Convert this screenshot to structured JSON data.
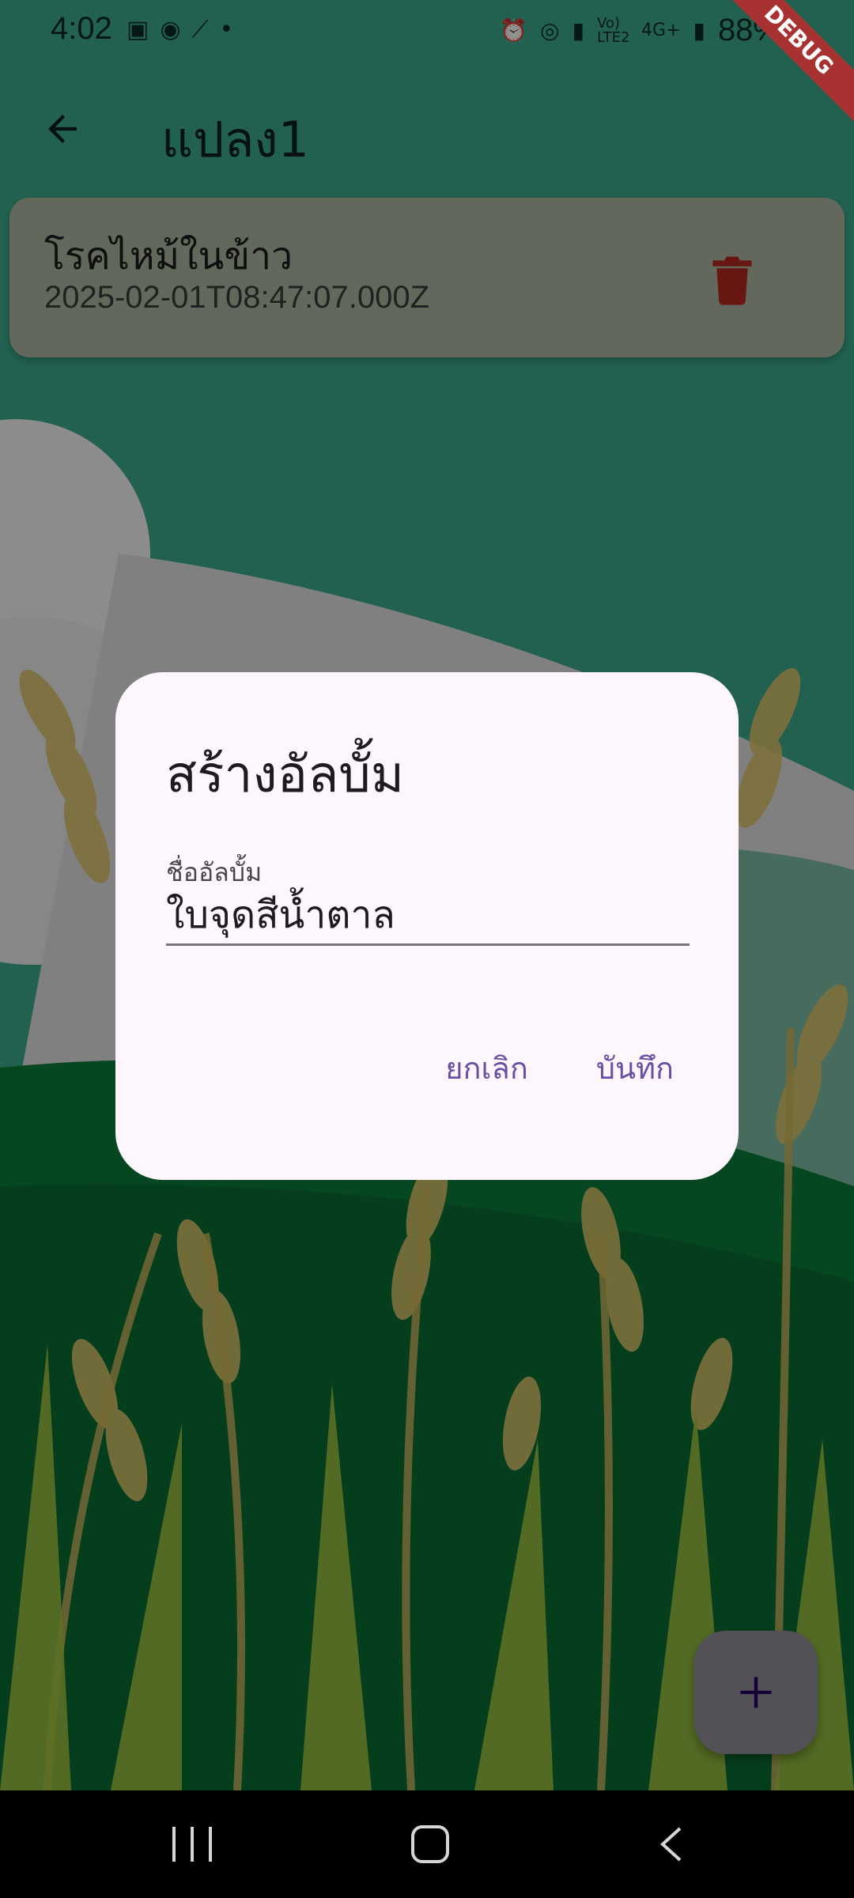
{
  "status_bar": {
    "time": "4:02",
    "left_icons": [
      "gallery-icon",
      "line-icon",
      "magic-wand-icon",
      "dot-icon"
    ],
    "right_icons": [
      "alarm-icon",
      "hotspot-icon",
      "signal-icon",
      "volte-icon",
      "4g-icon",
      "signal-icon"
    ],
    "volte_label": "Vo) LTE2",
    "network_label": "4G+",
    "battery": "88%",
    "debug_label": "DEBUG"
  },
  "app_bar": {
    "title": "แปลง1"
  },
  "list": {
    "items": [
      {
        "title": "โรคไหม้ในข้าว",
        "subtitle": "2025-02-01T08:47:07.000Z"
      }
    ]
  },
  "dialog": {
    "title": "สร้างอัลบั้ม",
    "field_label": "ชื่ออัลบั้ม",
    "field_value": "ใบจุดสีน้ำตาล",
    "cancel_label": "ยกเลิก",
    "save_label": "บันทึก"
  },
  "colors": {
    "accent": "#6750a4",
    "delete": "#b3261e",
    "dialog_bg": "#fdf6fc"
  }
}
